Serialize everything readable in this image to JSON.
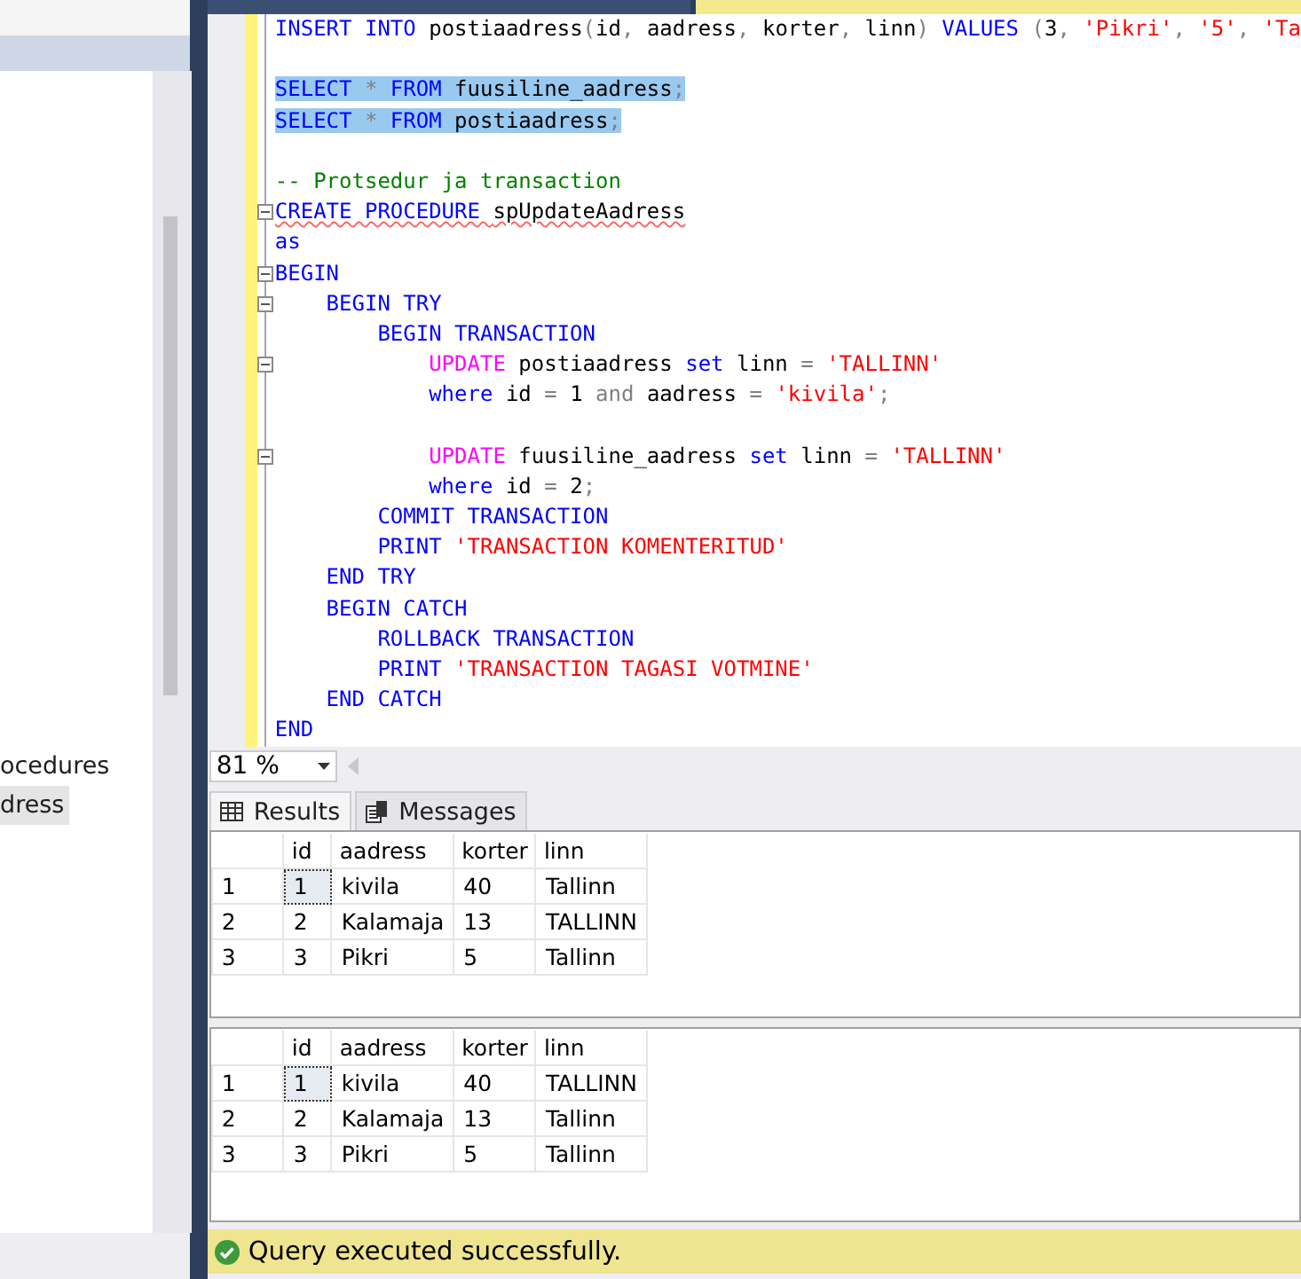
{
  "object_explorer": {
    "items": [
      {
        "label": "ocedures",
        "selected": false
      },
      {
        "label": "dress",
        "selected": true
      }
    ]
  },
  "editor": {
    "lines": [
      {
        "kind": "code",
        "selected": false,
        "fold": false,
        "error": false,
        "tokens": [
          {
            "kind": "keyword",
            "t": "INSERT INTO "
          },
          {
            "kind": "plain",
            "t": "postiaadress"
          },
          {
            "kind": "operator",
            "t": "("
          },
          {
            "kind": "plain",
            "t": "id"
          },
          {
            "kind": "operator",
            "t": ", "
          },
          {
            "kind": "plain",
            "t": "aadress"
          },
          {
            "kind": "operator",
            "t": ", "
          },
          {
            "kind": "plain",
            "t": "korter"
          },
          {
            "kind": "operator",
            "t": ", "
          },
          {
            "kind": "plain",
            "t": "linn"
          },
          {
            "kind": "operator",
            "t": ") "
          },
          {
            "kind": "keyword",
            "t": "VALUES "
          },
          {
            "kind": "operator",
            "t": "("
          },
          {
            "kind": "plain",
            "t": "3"
          },
          {
            "kind": "operator",
            "t": ", "
          },
          {
            "kind": "string",
            "t": "'Pikri'"
          },
          {
            "kind": "operator",
            "t": ", "
          },
          {
            "kind": "string",
            "t": "'5'"
          },
          {
            "kind": "operator",
            "t": ", "
          },
          {
            "kind": "string",
            "t": "'Ta"
          }
        ]
      },
      {
        "kind": "blank"
      },
      {
        "kind": "code",
        "selected": true,
        "fold": false,
        "error": false,
        "tokens": [
          {
            "kind": "keyword",
            "t": "SELECT "
          },
          {
            "kind": "operator",
            "t": "* "
          },
          {
            "kind": "keyword",
            "t": "FROM "
          },
          {
            "kind": "plain",
            "t": "fuusiline_aadress"
          },
          {
            "kind": "operator",
            "t": ";"
          }
        ]
      },
      {
        "kind": "code",
        "selected": true,
        "fold": false,
        "error": false,
        "tokens": [
          {
            "kind": "keyword",
            "t": "SELECT "
          },
          {
            "kind": "operator",
            "t": "* "
          },
          {
            "kind": "keyword",
            "t": "FROM "
          },
          {
            "kind": "plain",
            "t": "postiaadress"
          },
          {
            "kind": "operator",
            "t": ";"
          }
        ]
      },
      {
        "kind": "blank"
      },
      {
        "kind": "code",
        "selected": false,
        "fold": false,
        "error": false,
        "tokens": [
          {
            "kind": "comment",
            "t": "-- Protsedur ja transaction"
          }
        ]
      },
      {
        "kind": "code",
        "selected": false,
        "fold": true,
        "error": true,
        "tokens": [
          {
            "kind": "keyword",
            "t": "CREATE PROCEDURE "
          },
          {
            "kind": "plain",
            "t": "spUpdateAadress"
          }
        ]
      },
      {
        "kind": "code",
        "selected": false,
        "fold": false,
        "error": false,
        "tokens": [
          {
            "kind": "keyword",
            "t": "as"
          }
        ]
      },
      {
        "kind": "code",
        "selected": false,
        "fold": true,
        "error": false,
        "tokens": [
          {
            "kind": "keyword",
            "t": "BEGIN"
          }
        ]
      },
      {
        "kind": "code",
        "selected": false,
        "fold": true,
        "error": false,
        "tokens": [
          {
            "kind": "keyword",
            "t": "    BEGIN TRY"
          }
        ]
      },
      {
        "kind": "code",
        "selected": false,
        "fold": false,
        "error": false,
        "tokens": [
          {
            "kind": "keyword",
            "t": "        BEGIN TRANSACTION"
          }
        ]
      },
      {
        "kind": "code",
        "selected": false,
        "fold": true,
        "error": false,
        "tokens": [
          {
            "kind": "function",
            "t": "            UPDATE "
          },
          {
            "kind": "plain",
            "t": "postiaadress "
          },
          {
            "kind": "keyword",
            "t": "set "
          },
          {
            "kind": "plain",
            "t": "linn "
          },
          {
            "kind": "operator",
            "t": "= "
          },
          {
            "kind": "string",
            "t": "'TALLINN'"
          }
        ]
      },
      {
        "kind": "code",
        "selected": false,
        "fold": false,
        "error": false,
        "tokens": [
          {
            "kind": "keyword",
            "t": "            where "
          },
          {
            "kind": "plain",
            "t": "id "
          },
          {
            "kind": "operator",
            "t": "= "
          },
          {
            "kind": "plain",
            "t": "1 "
          },
          {
            "kind": "operator",
            "t": "and "
          },
          {
            "kind": "plain",
            "t": "aadress "
          },
          {
            "kind": "operator",
            "t": "= "
          },
          {
            "kind": "string",
            "t": "'kivila'"
          },
          {
            "kind": "operator",
            "t": ";"
          }
        ]
      },
      {
        "kind": "blank"
      },
      {
        "kind": "code",
        "selected": false,
        "fold": true,
        "error": false,
        "tokens": [
          {
            "kind": "function",
            "t": "            UPDATE "
          },
          {
            "kind": "plain",
            "t": "fuusiline_aadress "
          },
          {
            "kind": "keyword",
            "t": "set "
          },
          {
            "kind": "plain",
            "t": "linn "
          },
          {
            "kind": "operator",
            "t": "= "
          },
          {
            "kind": "string",
            "t": "'TALLINN'"
          }
        ]
      },
      {
        "kind": "code",
        "selected": false,
        "fold": false,
        "error": false,
        "tokens": [
          {
            "kind": "keyword",
            "t": "            where "
          },
          {
            "kind": "plain",
            "t": "id "
          },
          {
            "kind": "operator",
            "t": "= "
          },
          {
            "kind": "plain",
            "t": "2"
          },
          {
            "kind": "operator",
            "t": ";"
          }
        ]
      },
      {
        "kind": "code",
        "selected": false,
        "fold": false,
        "error": false,
        "tokens": [
          {
            "kind": "keyword",
            "t": "        COMMIT TRANSACTION"
          }
        ]
      },
      {
        "kind": "code",
        "selected": false,
        "fold": false,
        "error": false,
        "tokens": [
          {
            "kind": "keyword",
            "t": "        PRINT "
          },
          {
            "kind": "string",
            "t": "'TRANSACTION KOMENTERITUD'"
          }
        ]
      },
      {
        "kind": "code",
        "selected": false,
        "fold": false,
        "error": false,
        "tokens": [
          {
            "kind": "keyword",
            "t": "    END TRY"
          }
        ]
      },
      {
        "kind": "code",
        "selected": false,
        "fold": false,
        "error": false,
        "tokens": [
          {
            "kind": "keyword",
            "t": "    BEGIN CATCH"
          }
        ]
      },
      {
        "kind": "code",
        "selected": false,
        "fold": false,
        "error": false,
        "tokens": [
          {
            "kind": "keyword",
            "t": "        ROLLBACK TRANSACTION"
          }
        ]
      },
      {
        "kind": "code",
        "selected": false,
        "fold": false,
        "error": false,
        "tokens": [
          {
            "kind": "keyword",
            "t": "        PRINT "
          },
          {
            "kind": "string",
            "t": "'TRANSACTION TAGASI VOTMINE'"
          }
        ]
      },
      {
        "kind": "code",
        "selected": false,
        "fold": false,
        "error": false,
        "tokens": [
          {
            "kind": "keyword",
            "t": "    END CATCH"
          }
        ]
      },
      {
        "kind": "code",
        "selected": false,
        "fold": false,
        "error": false,
        "tokens": [
          {
            "kind": "keyword",
            "t": "END"
          }
        ]
      }
    ]
  },
  "zoom": {
    "value": "81 %"
  },
  "result_tabs": [
    {
      "label": "Results",
      "selected": true,
      "kind": "grid"
    },
    {
      "label": "Messages",
      "selected": false,
      "kind": "messages"
    }
  ],
  "grids": [
    {
      "columns": [
        "id",
        "aadress",
        "korter",
        "linn"
      ],
      "rows": [
        {
          "number": "1",
          "cells": [
            "1",
            "kivila",
            "40",
            "Tallinn"
          ]
        },
        {
          "number": "2",
          "cells": [
            "2",
            "Kalamaja",
            "13",
            "TALLINN"
          ]
        },
        {
          "number": "3",
          "cells": [
            "3",
            "Pikri",
            "5",
            "Tallinn"
          ]
        }
      ]
    },
    {
      "columns": [
        "id",
        "aadress",
        "korter",
        "linn"
      ],
      "rows": [
        {
          "number": "1",
          "cells": [
            "1",
            "kivila",
            "40",
            "TALLINN"
          ]
        },
        {
          "number": "2",
          "cells": [
            "2",
            "Kalamaja",
            "13",
            "Tallinn"
          ]
        },
        {
          "number": "3",
          "cells": [
            "3",
            "Pikri",
            "5",
            "Tallinn"
          ]
        }
      ]
    }
  ],
  "status_bar": {
    "message": "Query executed successfully."
  }
}
